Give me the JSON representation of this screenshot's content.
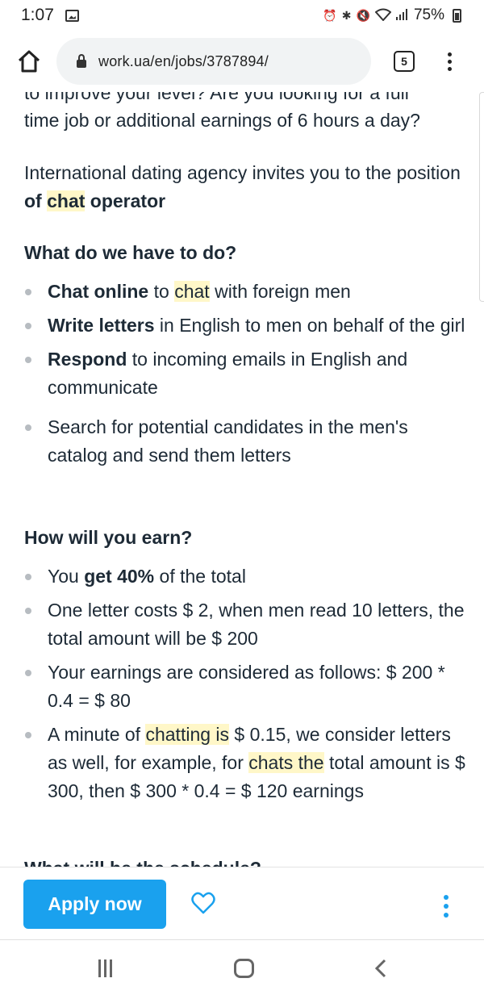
{
  "status_bar": {
    "time": "1:07",
    "battery": "75%",
    "icons": [
      "image-icon",
      "alarm-icon",
      "bluetooth-icon",
      "mute-icon",
      "wifi-icon",
      "signal-icon",
      "battery-icon"
    ]
  },
  "browser": {
    "url": "work.ua/en/jobs/3787894/",
    "tab_count": "5"
  },
  "content": {
    "cut_line": "to improve your level? Are you looking for a full",
    "p1_line": "time job or additional earnings of 6 hours a day?",
    "p2_text": "International dating agency invites you to the position ",
    "p2_of": "of ",
    "p2_chat": "chat",
    "p2_operator": " operator",
    "heading1": "What do we have to do?",
    "list1": [
      {
        "bold": "Chat online",
        "mid": " to ",
        "hl": "chat",
        "rest": " with foreign men"
      },
      {
        "bold": "Write letters",
        "rest": " in English to men on behalf of the girl"
      },
      {
        "bold": "Respond",
        "rest": " to incoming emails in English and communicate"
      },
      {
        "rest": "Search for potential candidates in the men's catalog and send them letters"
      }
    ],
    "heading2": "How will you earn?",
    "list2": [
      {
        "pre": "You ",
        "bold": "get 40%",
        "rest": " of the total"
      },
      {
        "rest": "One letter costs $ 2, when men read 10 letters, the total amount will be $ 200"
      },
      {
        "rest": "Your earnings are considered as follows: $ 200 * 0.4 = $ 80"
      },
      {
        "pre": "A minute of ",
        "hl1": "chatting is",
        "mid": " $ 0.15, we consider letters as well, for example, for ",
        "hl2": "chats the",
        "rest": " total amount is $ 300, then $ 300 * 0.4 = $ 120 earnings"
      }
    ],
    "heading3": "What will be the schedule?"
  },
  "actions": {
    "apply_label": "Apply now"
  },
  "colors": {
    "accent": "#1aa1ee",
    "highlight": "#fff7c8",
    "text": "#1d2a36"
  }
}
